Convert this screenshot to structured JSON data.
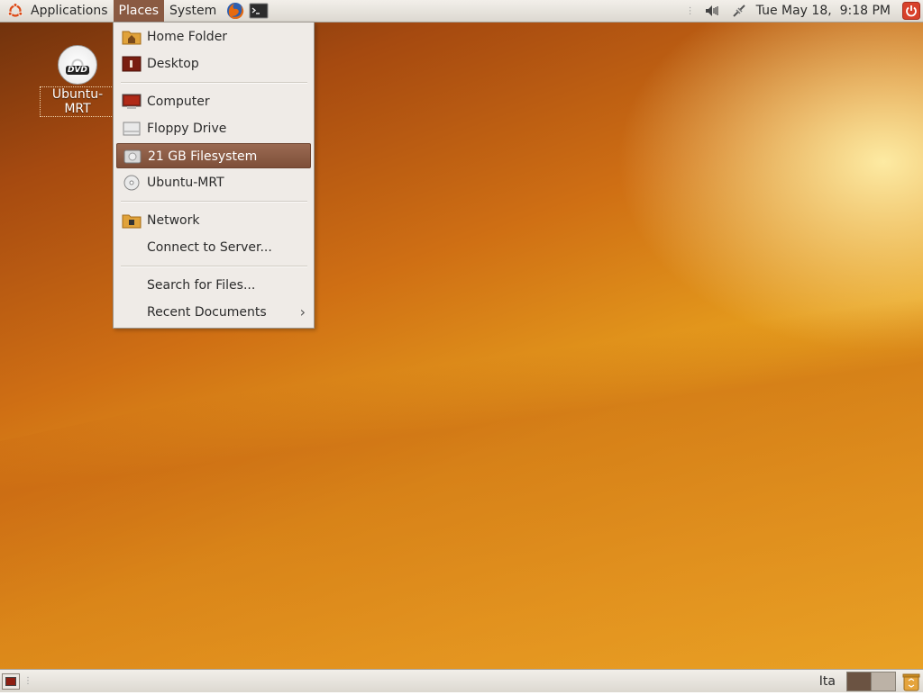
{
  "top_panel": {
    "menus": [
      "Applications",
      "Places",
      "System"
    ],
    "clock": "Tue May 18,  9:18 PM"
  },
  "desktop": {
    "icon_label": "Ubuntu-MRT",
    "icon_badge": "DVD"
  },
  "places_menu": {
    "items": [
      {
        "label": "Home Folder",
        "icon": "home-folder-icon"
      },
      {
        "label": "Desktop",
        "icon": "desktop-folder-icon"
      },
      {
        "label": "Computer",
        "icon": "computer-icon"
      },
      {
        "label": "Floppy Drive",
        "icon": "floppy-drive-icon"
      },
      {
        "label": "21 GB Filesystem",
        "icon": "harddisk-icon",
        "selected": true
      },
      {
        "label": "Ubuntu-MRT",
        "icon": "cdrom-icon"
      },
      {
        "label": "Network",
        "icon": "network-folder-icon"
      },
      {
        "label": "Connect to Server...",
        "icon": ""
      },
      {
        "label": "Search for Files...",
        "icon": ""
      },
      {
        "label": "Recent Documents",
        "icon": "",
        "submenu": true
      }
    ]
  },
  "bottom_panel": {
    "keyboard_layout": "Ita"
  },
  "colors": {
    "accent": "#8a5a42",
    "panel": "#e8e5df",
    "menu_bg": "#efebe7"
  }
}
